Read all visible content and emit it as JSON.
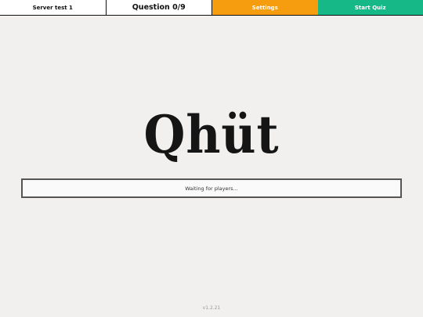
{
  "topbar": {
    "server_name": "Server test 1",
    "question_label": "Question 0/9",
    "settings_label": "Settings",
    "start_label": "Start Quiz"
  },
  "logo": {
    "text": "Qhüt"
  },
  "status": {
    "text": "Waiting for players..."
  },
  "footer": {
    "version": "v1.2.21"
  },
  "colors": {
    "background": "#f1f0ee",
    "settings": "#f59c0f",
    "start": "#17b887",
    "border": "#111111"
  }
}
